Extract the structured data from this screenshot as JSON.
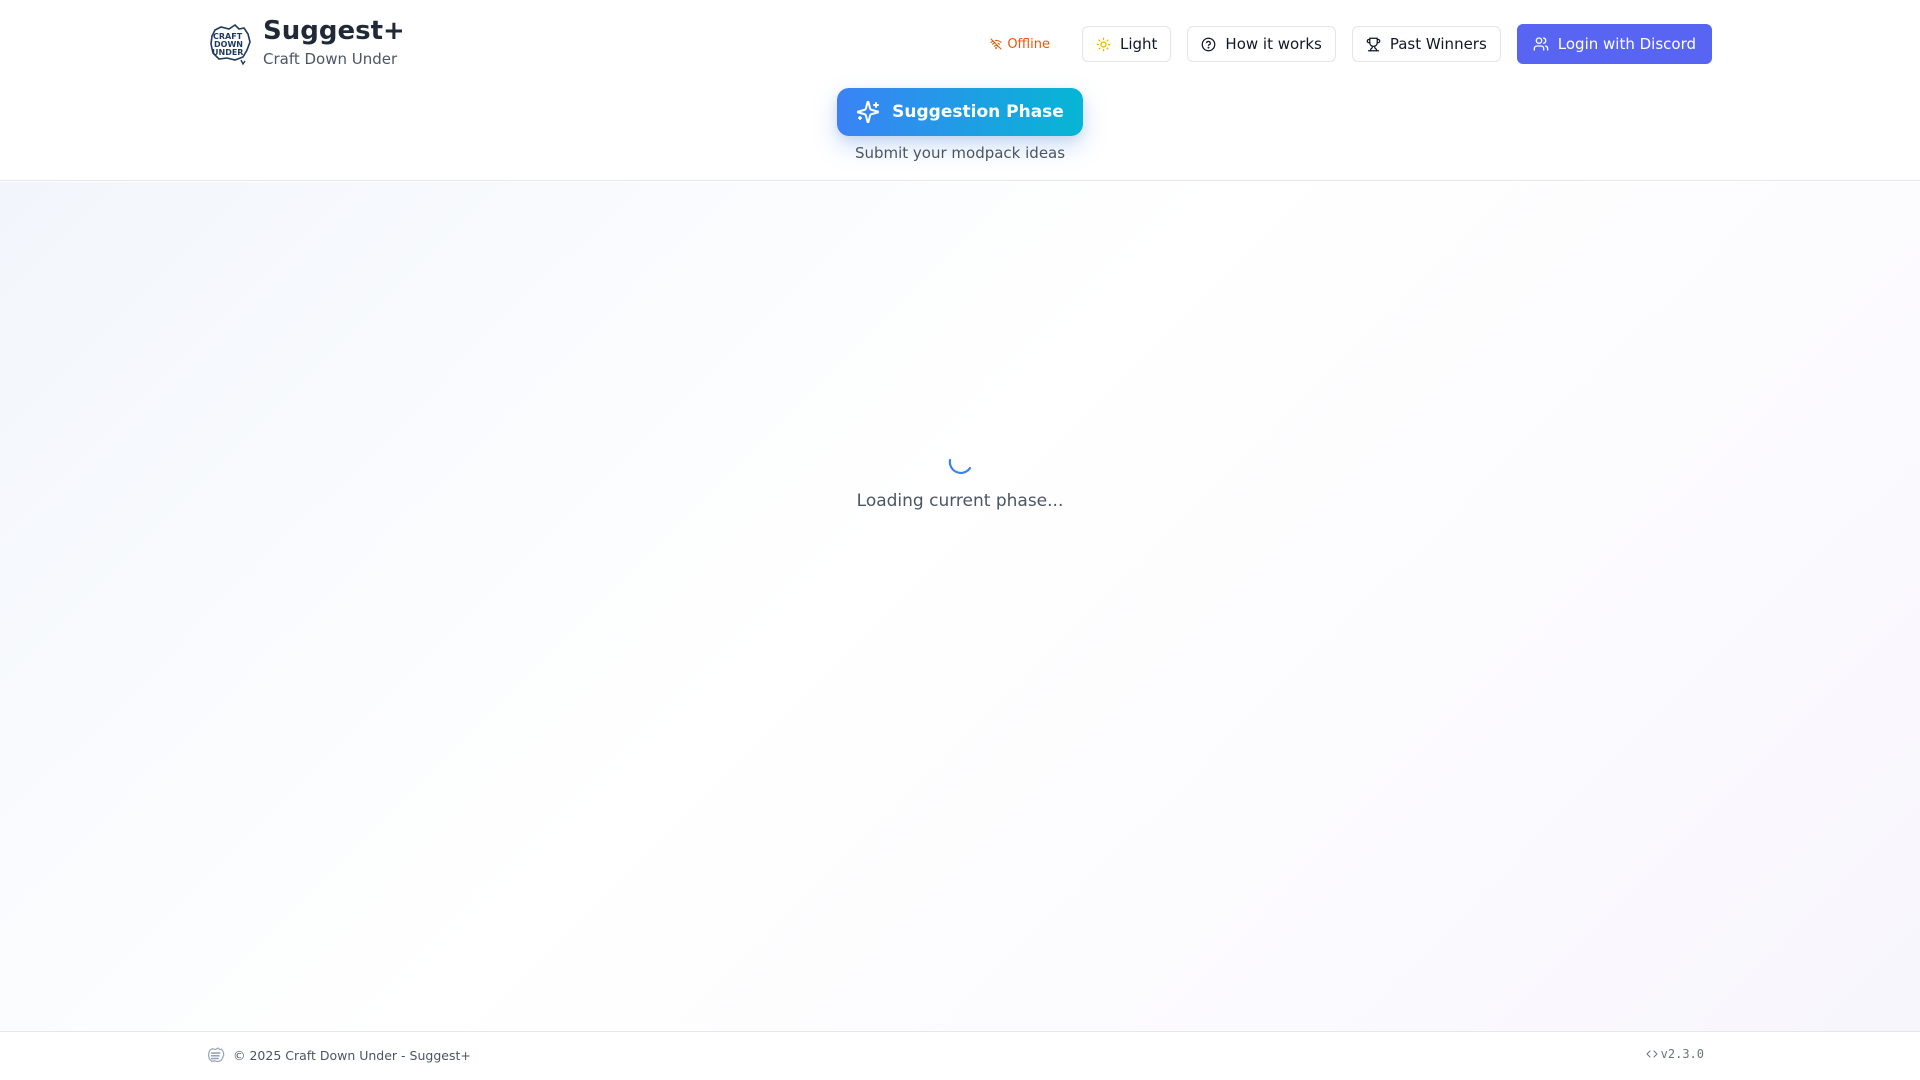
{
  "header": {
    "app_title": "Suggest+",
    "app_subtitle": "Craft Down Under",
    "logo_text": [
      "CRAFT",
      "DOWN",
      "UNDER"
    ]
  },
  "nav": {
    "status_label": "Offline",
    "status_icon": "wifi-off-icon",
    "theme_label": "Light",
    "theme_icon": "sun-icon",
    "how_label": "How it works",
    "how_icon": "help-circle-icon",
    "winners_label": "Past Winners",
    "winners_icon": "trophy-icon",
    "login_label": "Login with Discord",
    "login_icon": "users-icon"
  },
  "phase": {
    "label": "Suggestion Phase",
    "icon": "sparkles-icon",
    "description": "Submit your modpack ideas"
  },
  "main": {
    "loading_text": "Loading current phase..."
  },
  "footer": {
    "copyright": "© 2025 Craft Down Under - Suggest+",
    "version": "v2.3.0",
    "version_icon": "code-icon"
  },
  "colors": {
    "accent_discord": "#5865f2",
    "phase_gradient_start": "#3b82f6",
    "phase_gradient_end": "#06b6d4",
    "status_offline": "#ea580c",
    "theme_sun": "#eab308"
  }
}
